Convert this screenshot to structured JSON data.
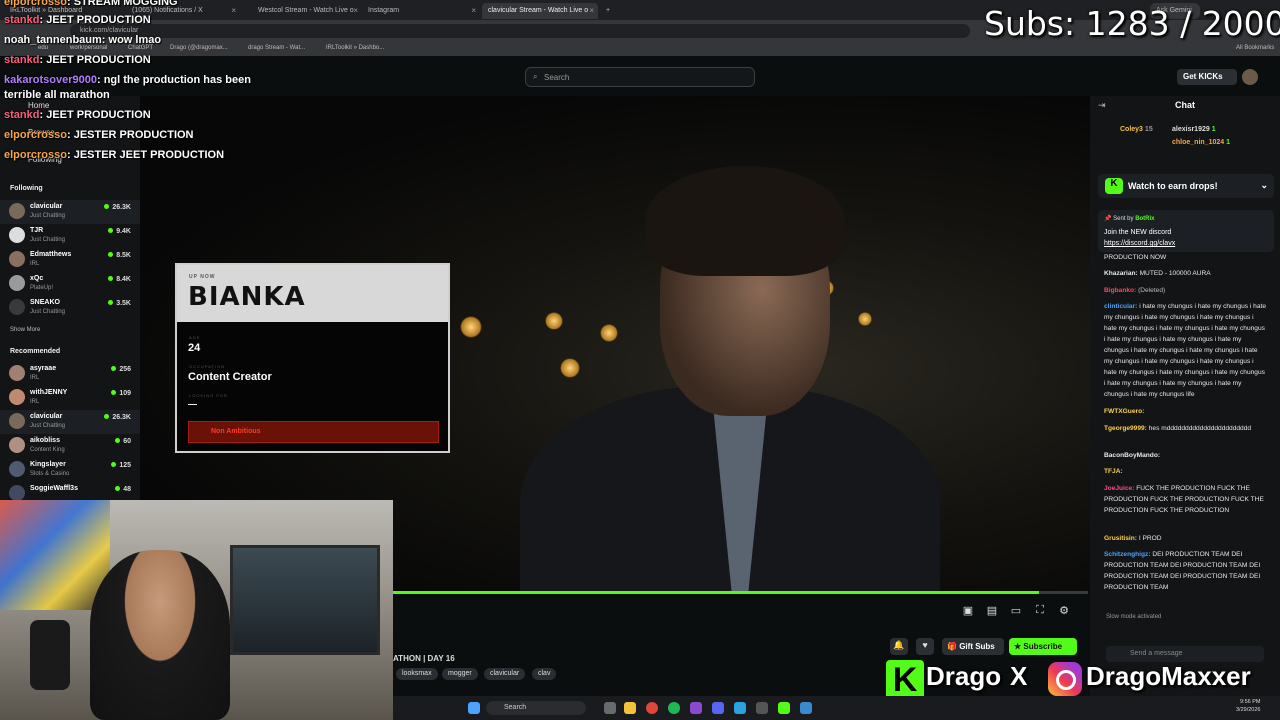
{
  "browser": {
    "tabs": [
      {
        "label": "IRLToolkit » Dashboard"
      },
      {
        "label": "(1065) Notifications / X"
      },
      {
        "label": "Westcol Stream - Watch Live o"
      },
      {
        "label": "Instagram"
      },
      {
        "label": "clavicular Stream - Watch Live o"
      }
    ],
    "url": "kick.com/clavicular",
    "bookmarks": [
      "edu",
      "work/personal",
      "ChatGPT",
      "Drago (@dragomax...",
      "drago Stream - Wat...",
      "IRLToolkit » Dashbo..."
    ],
    "gemini": "Ask Gemini",
    "all_bookmarks": "All Bookmarks"
  },
  "overlay_chat": [
    {
      "user": "elporcrosso",
      "msg": "STREAM MOGGING"
    },
    {
      "user": "stankd",
      "msg": "JEET PRODUCTION"
    },
    {
      "user": "noah_tannenbaum",
      "msg": "wow lmao"
    },
    {
      "user": "stankd",
      "msg": "JEET PRODUCTION"
    },
    {
      "user": "kakarotsover9000",
      "msg": "ngl the production has been"
    },
    {
      "user": "",
      "msg": "terrible all marathon"
    },
    {
      "user": "stankd",
      "msg": "JEET PRODUCTION"
    },
    {
      "user": "elporcrosso",
      "msg": "JESTER PRODUCTION"
    },
    {
      "user": "elporcrosso",
      "msg": "JESTER JEET PRODUCTION"
    }
  ],
  "header": {
    "search_placeholder": "Search",
    "get_kicks": "Get KICKs"
  },
  "sidebar": {
    "home": "Home",
    "browse": "Browse",
    "following_nav": "Following",
    "following_label": "Following",
    "following": [
      {
        "name": "clavicular",
        "category": "Just Chatting",
        "viewers": "26.3K"
      },
      {
        "name": "TJR",
        "category": "Just Chatting",
        "viewers": "9.4K"
      },
      {
        "name": "Edmatthews",
        "category": "IRL",
        "viewers": "8.5K"
      },
      {
        "name": "xQc",
        "category": "PlateUp!",
        "viewers": "8.4K"
      },
      {
        "name": "SNEAKO",
        "category": "Just Chatting",
        "viewers": "3.5K"
      }
    ],
    "show_more": "Show More",
    "recommended_label": "Recommended",
    "recommended": [
      {
        "name": "asyraae",
        "category": "IRL",
        "viewers": "256"
      },
      {
        "name": "withJENNY",
        "category": "IRL",
        "viewers": "109"
      },
      {
        "name": "clavicular",
        "category": "Just Chatting",
        "viewers": "26.3K"
      },
      {
        "name": "aikobliss",
        "category": "Content King",
        "viewers": "60"
      },
      {
        "name": "Kingslayer",
        "category": "Slots & Casino",
        "viewers": "125"
      },
      {
        "name": "SoggieWaffl3s",
        "category": "",
        "viewers": "48"
      }
    ]
  },
  "card": {
    "up_now": "UP NOW",
    "name": "BIANKA",
    "age_label": "AGE",
    "age": "24",
    "occupation_label": "OCCUPATION",
    "occupation": "Content Creator",
    "looking_for_label": "LOOKING FOR",
    "looking_for": "—",
    "flag": "Non Ambitious"
  },
  "player": {
    "progress": 0.93
  },
  "stream": {
    "title": "ATHON | DAY 16",
    "tags": [
      "looksmax",
      "mogger",
      "clavicular",
      "clav"
    ],
    "gift_subs": "Gift Subs",
    "subscribe": "Subscribe"
  },
  "subs_overlay": "Subs: 1283 / 2000",
  "social": {
    "kick_name": "Drago",
    "x_glyph": "X",
    "instagram_name": "DragoMaxxer"
  },
  "chat": {
    "title": "Chat",
    "gifters": [
      {
        "name": "Coley3",
        "count": "15"
      },
      {
        "name": "alexisr1929",
        "count": "1"
      },
      {
        "name": "chloe_nin_1024",
        "count": "1"
      }
    ],
    "drops": "Watch to earn drops!",
    "pinned": {
      "sent_by": "Sent by",
      "bot": "BotRix",
      "text": "Join the NEW discord",
      "link": "https://discord.gg/clavx"
    },
    "messages": [
      {
        "user": "",
        "text": "PRODUCTION NOW",
        "color": "#e8e8e8"
      },
      {
        "user": "Khazarian:",
        "text": "MUTED - 100000 AURA",
        "color": "#e8e8e8"
      },
      {
        "user": "Bigbanko:",
        "text": "(Deleted)",
        "color": "#ff4a5a"
      },
      {
        "user": "clinticular:",
        "text": "i hate my chungus i hate my chungus i hate my chungus i hate my chungus i hate my chungus i hate my chungus i hate my chungus i hate my chungus i hate my chungus i hate my chungus i hate my chungus i hate my chungus i hate my chungus i hate my chungus i hate my chungus i hate my chungus i hate my chungus i hate my chungus i hate my chungus i hate my chungus i hate my chungus i hate my chungus i hate my chungus life",
        "color": "#4aa3ff"
      },
      {
        "user": "FWTXGuero:",
        "text": "",
        "color": "#ffd24a"
      },
      {
        "user": "Tgeorge9999:",
        "text": "hes mddddddddddddddddddddddd",
        "color": "#ffd24a"
      },
      {
        "user": "BaconBoyMando:",
        "text": "",
        "color": "#e8e8e8"
      },
      {
        "user": "TFJA:",
        "text": "",
        "color": "#ffd24a"
      },
      {
        "user": "JoeJuice:",
        "text": "FUCK THE PRODUCTION FUCK THE PRODUCTION FUCK THE PRODUCTION FUCK THE PRODUCTION FUCK THE PRODUCTION",
        "color": "#ff4a8a"
      },
      {
        "user": "Grusitisin:",
        "text": "I PROD",
        "color": "#ffd24a"
      },
      {
        "user": "Schitzenghigz:",
        "text": "DEI PRODUCTION TEAM DEI PRODUCTION TEAM DEI PRODUCTION TEAM DEI PRODUCTION TEAM DEI PRODUCTION TEAM DEI PRODUCTION TEAM",
        "color": "#4aa3ff"
      }
    ],
    "slow_mode": "Slow mode activated",
    "input_placeholder": "Send a message"
  },
  "taskbar": {
    "search": "Search",
    "time": "9:56 PM",
    "date": "3/29/2026"
  },
  "colors": {
    "kick_green": "#53fc18",
    "background": "#0b0e0f",
    "sidebar": "#121416"
  },
  "icons": [
    "search-icon",
    "kick-logo-icon",
    "instagram-icon",
    "x-logo-icon",
    "settings-icon",
    "fullscreen-icon",
    "theater-icon",
    "bell-icon",
    "heart-icon",
    "gift-icon",
    "star-icon",
    "collapse-icon",
    "pin-icon",
    "windows-start-icon"
  ]
}
